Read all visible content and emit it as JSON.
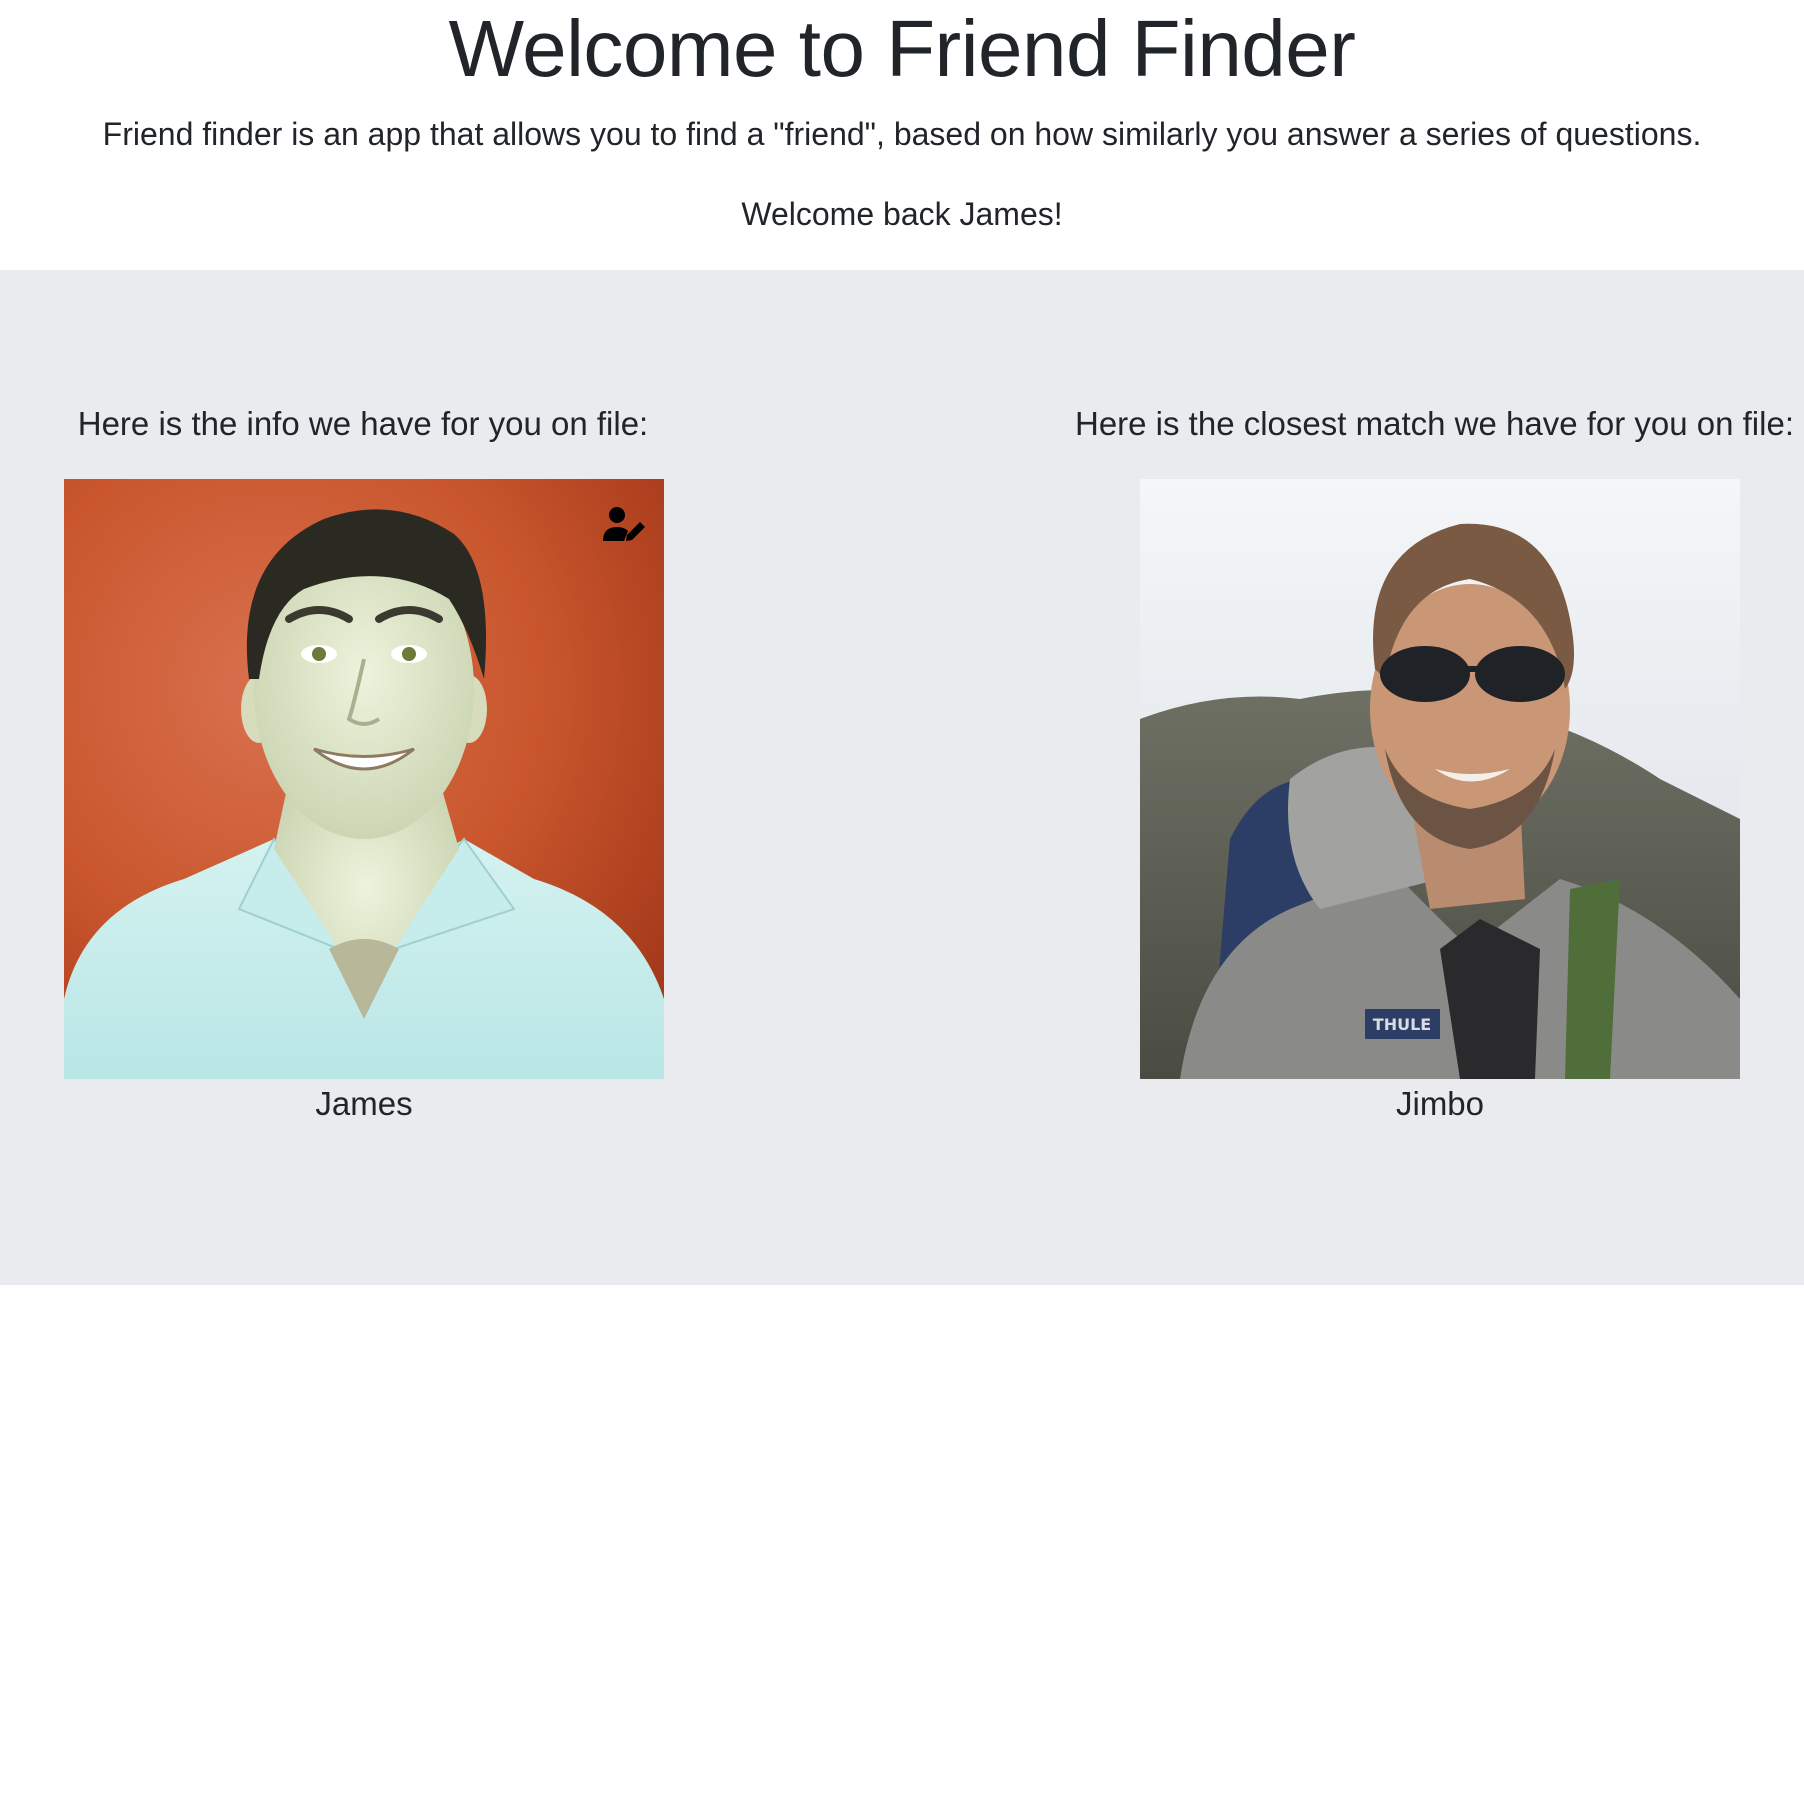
{
  "header": {
    "title": "Welcome to Friend Finder",
    "intro": "Friend finder is an app that allows you to find a \"friend\", based on how similarly you answer a series of questions.",
    "welcome_back": "Welcome back James!"
  },
  "profile": {
    "heading": "Here is the info we have for you on file:",
    "name": "James",
    "edit_icon": "user-edit-icon"
  },
  "match": {
    "heading": "Here is the closest match we have for you on file:",
    "name": "Jimbo"
  },
  "colors": {
    "text": "#212529",
    "section_background": "#e9ebef",
    "page_background": "#ffffff"
  }
}
